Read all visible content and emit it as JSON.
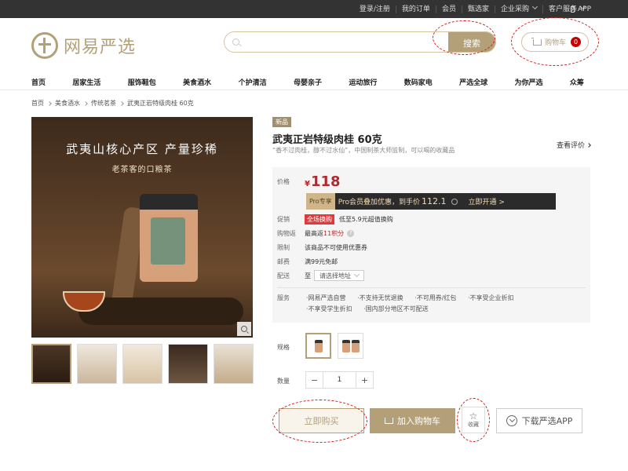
{
  "topbar": {
    "links": [
      "登录/注册",
      "我的订单",
      "会员",
      "甄选家",
      "企业采购",
      "客户服务"
    ],
    "app": "APP"
  },
  "header": {
    "logo_text": "网易严选",
    "search_placeholder": "",
    "search_button": "搜索",
    "cart_label": "购物车",
    "cart_count": "0"
  },
  "nav": [
    "首页",
    "居家生活",
    "服饰鞋包",
    "美食酒水",
    "个护清洁",
    "母婴亲子",
    "运动旅行",
    "数码家电",
    "严选全球",
    "为你严选",
    "众筹"
  ],
  "breadcrumb": [
    "首页",
    "美食酒水",
    "传统茗茶",
    "武夷正岩特级肉桂 60克"
  ],
  "gallery": {
    "headline": "武夷山核心产区 产量珍稀",
    "subline": "老茶客的口粮茶",
    "thumb_count": 5
  },
  "product": {
    "tag": "新品",
    "title": "武夷正岩特级肉桂 60克",
    "desc": "“香不过肉桂，醇不过水仙”，中国制茶大师监制，可以喝的收藏品",
    "review_link": "查看评价"
  },
  "pricebox": {
    "price_label": "价格",
    "currency": "¥",
    "price": "118",
    "pro_tag": "Pro专享",
    "pro_text": "Pro会员叠加优惠，到手价",
    "pro_price": "112.1",
    "pro_open": "立即开通 >",
    "promo_label": "促销",
    "promo_tag": "全场换购",
    "promo_text": "低至5.9元超值换购",
    "points_label": "购物返",
    "points_prefix": "最高返",
    "points_value": "11积分",
    "limit_label": "限制",
    "limit_text": "该商品不可使用优惠券",
    "ship_label": "邮费",
    "ship_text": "满99元免邮",
    "deliver_label": "配送",
    "deliver_to": "至",
    "deliver_select": "请选择地址",
    "service_label": "服务",
    "services": [
      "网易严选自营",
      "不支持无忧退换",
      "不可用券/红包",
      "不享受企业折扣",
      "不享受学生折扣",
      "国内部分地区不可配送"
    ]
  },
  "spec": {
    "label": "规格"
  },
  "quantity": {
    "label": "数量",
    "minus": "−",
    "value": "1",
    "plus": "+"
  },
  "actions": {
    "buy_now": "立即购买",
    "add_cart": "加入购物车",
    "favorite": "收藏",
    "download": "下载严选APP"
  },
  "colors": {
    "brand_gold": "#b4a078",
    "price_red": "#b4282d",
    "annotation_red": "#d21e1e"
  }
}
